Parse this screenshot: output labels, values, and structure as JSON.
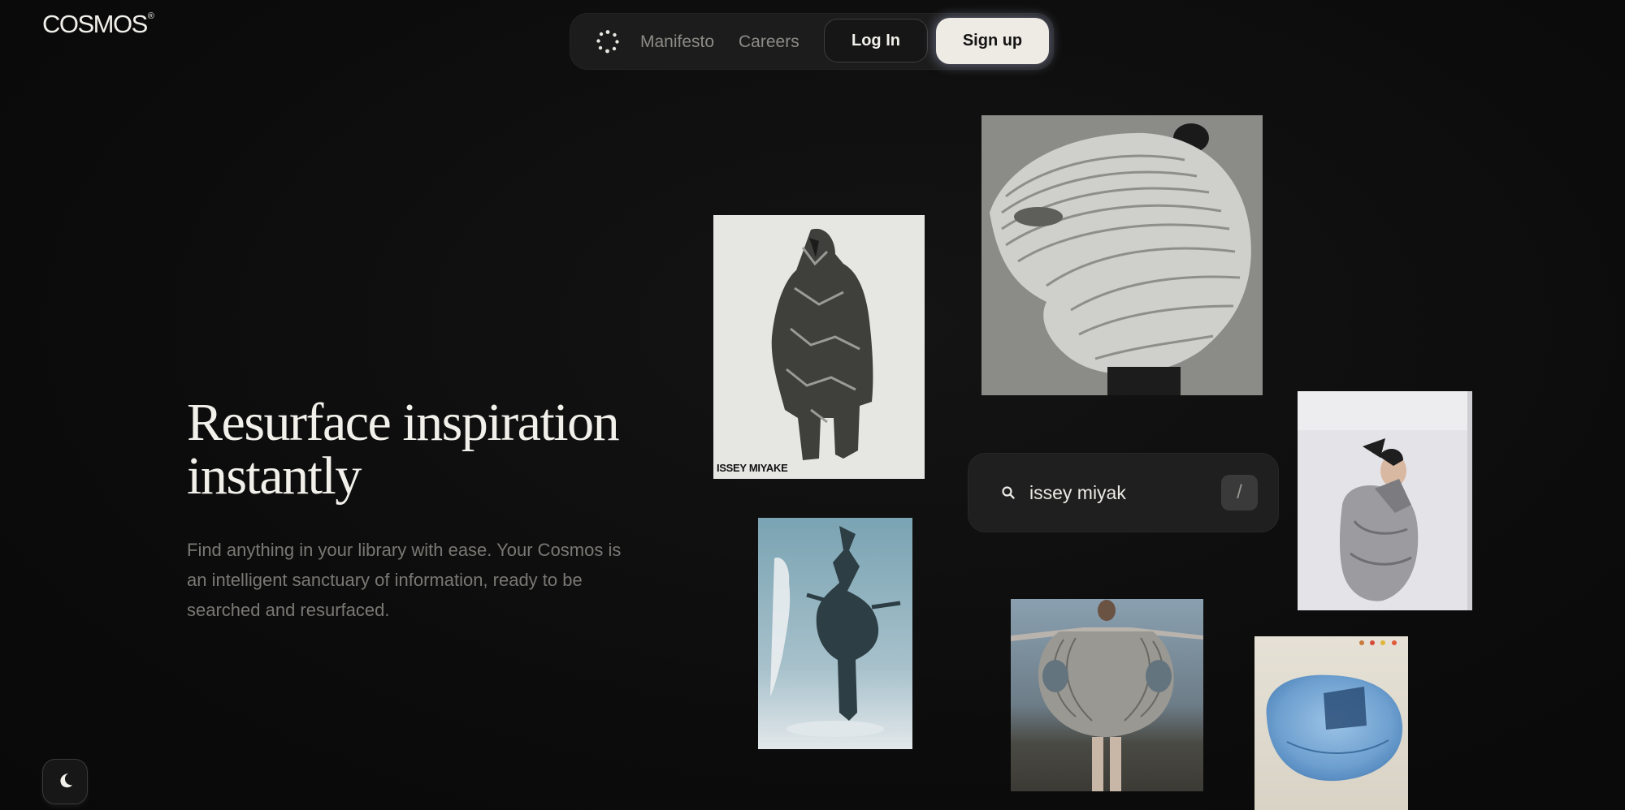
{
  "brand": {
    "name": "COSMOS",
    "mark": "®"
  },
  "nav": {
    "logo_icon": "dots-circle-icon",
    "links": [
      {
        "label": "Manifesto"
      },
      {
        "label": "Careers"
      }
    ],
    "login_label": "Log In",
    "signup_label": "Sign up"
  },
  "hero": {
    "title_line1": "Resurface inspiration",
    "title_line2": "instantly",
    "subtitle": "Find anything in your library with ease. Your Cosmos is an intelligent sanctuary of information, ready to be searched and resurfaced."
  },
  "search": {
    "icon": "search-icon",
    "value": "issey miyak",
    "shortcut": "/"
  },
  "cards": {
    "poster_caption": "ISSEY MIYAKE"
  },
  "theme_toggle": {
    "icon": "moon-icon"
  },
  "colors": {
    "background": "#0c0c0c",
    "signup_bg": "#eeebe4",
    "text_primary": "#f2f0ea",
    "text_muted": "#7a7874"
  }
}
